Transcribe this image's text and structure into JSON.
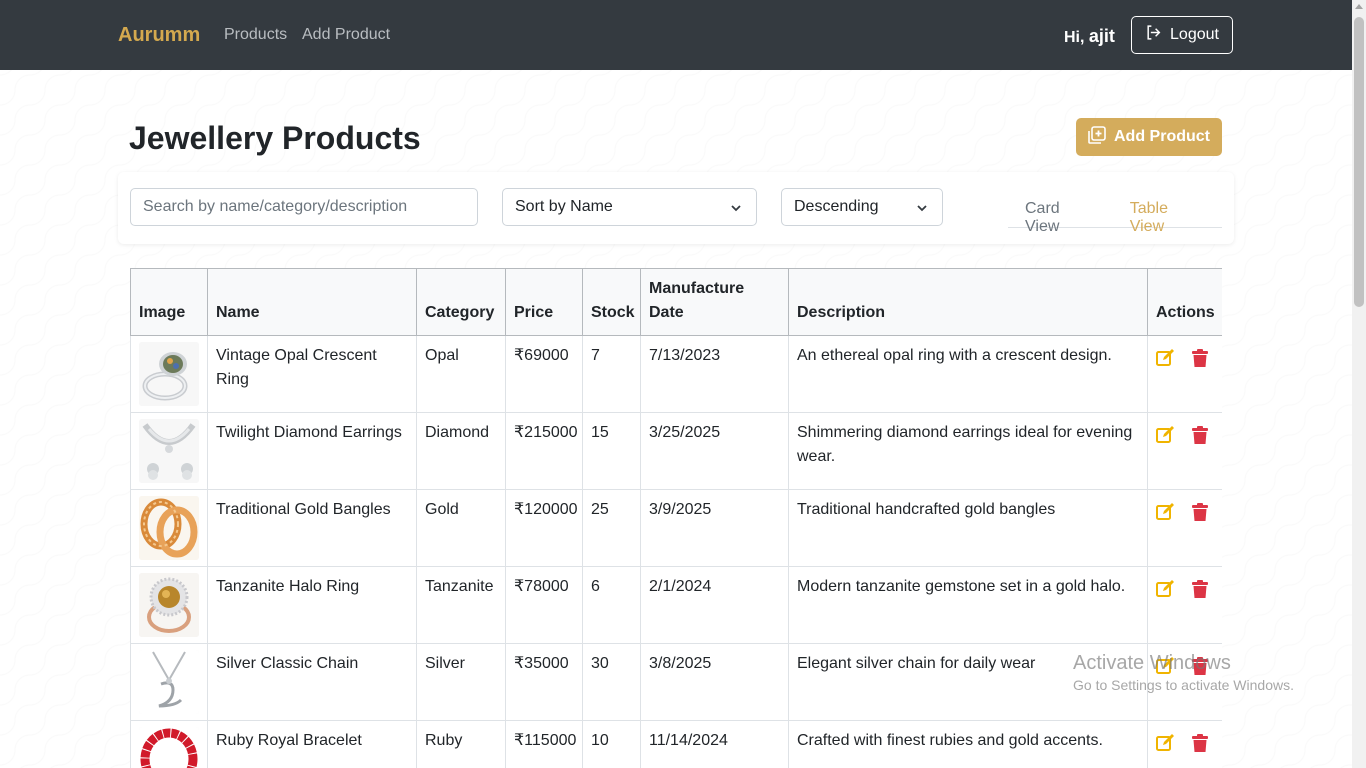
{
  "navbar": {
    "brand": "Aurumm",
    "links": [
      "Products",
      "Add Product"
    ],
    "greeting_prefix": "Hi,",
    "username": "ajit",
    "logout_label": "Logout"
  },
  "header": {
    "title": "Jewellery Products",
    "add_button_label": "Add Product"
  },
  "filters": {
    "search_placeholder": "Search by name/category/description",
    "sort_by": "Sort by Name",
    "order": "Descending",
    "view_tabs": [
      "Card View",
      "Table View"
    ],
    "active_view": "Table View"
  },
  "table": {
    "columns": [
      "Image",
      "Name",
      "Category",
      "Price",
      "Stock",
      "Manufacture Date",
      "Description",
      "Actions"
    ],
    "rows": [
      {
        "name": "Vintage Opal Crescent Ring",
        "category": "Opal",
        "price": "₹69000",
        "stock": "7",
        "date": "7/13/2023",
        "description": "An ethereal opal ring with a crescent design."
      },
      {
        "name": "Twilight Diamond Earrings",
        "category": "Diamond",
        "price": "₹215000",
        "stock": "15",
        "date": "3/25/2025",
        "description": "Shimmering diamond earrings ideal for evening wear."
      },
      {
        "name": "Traditional Gold Bangles",
        "category": "Gold",
        "price": "₹120000",
        "stock": "25",
        "date": "3/9/2025",
        "description": "Traditional handcrafted gold bangles"
      },
      {
        "name": "Tanzanite Halo Ring",
        "category": "Tanzanite",
        "price": "₹78000",
        "stock": "6",
        "date": "2/1/2024",
        "description": "Modern tanzanite gemstone set in a gold halo."
      },
      {
        "name": "Silver Classic Chain",
        "category": "Silver",
        "price": "₹35000",
        "stock": "30",
        "date": "3/8/2025",
        "description": "Elegant silver chain for daily wear"
      },
      {
        "name": "Ruby Royal Bracelet",
        "category": "Ruby",
        "price": "₹115000",
        "stock": "10",
        "date": "11/14/2024",
        "description": "Crafted with finest rubies and gold accents."
      }
    ]
  },
  "watermark": {
    "title": "Activate Windows",
    "subtitle": "Go to Settings to activate Windows."
  },
  "colors": {
    "navbar_bg": "#343a40",
    "brand": "#d4a94f",
    "accent": "#d4ac5c",
    "edit_icon": "#f0b400",
    "delete_icon": "#dc3545"
  },
  "icons": {
    "logout": "logout-icon",
    "add": "add-square-icon",
    "edit": "edit-icon",
    "delete": "trash-icon"
  }
}
